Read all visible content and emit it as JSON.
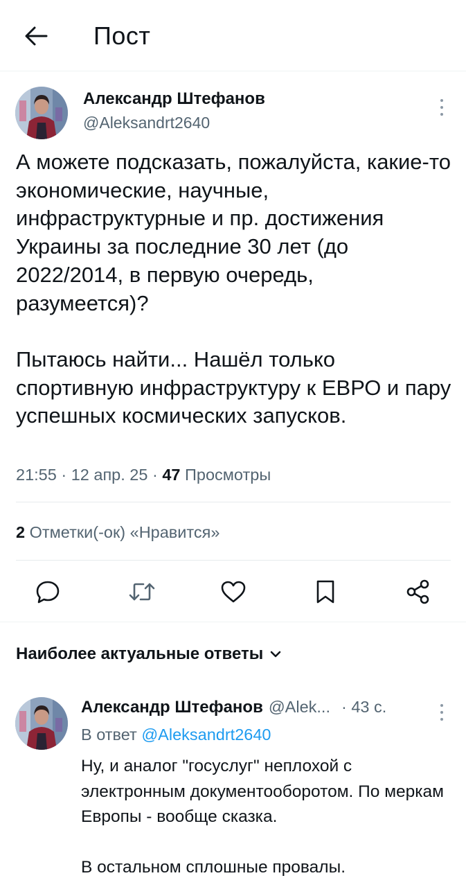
{
  "header": {
    "title": "Пост"
  },
  "tweet": {
    "author_name": "Александр Штефанов",
    "author_handle": "@Aleksandrt2640",
    "text": "А можете подсказать, пожалуйста, какие-то экономические, научные, инфраструктурные и пр. достижения Украины за последние 30 лет (до 2022/2014, в первую очередь, разумеется)?\n\nПытаюсь найти... Нашёл только спортивную инфраструктуру к ЕВРО и пару успешных космических запусков.",
    "time": "21:55",
    "date": "12 апр. 25",
    "separator": "·",
    "views_count": "47",
    "views_label": "Просмотры",
    "likes_count": "2",
    "likes_label": "Отметки(-ок) «Нравится»"
  },
  "actions": [
    "reply-icon",
    "retweet-icon",
    "like-icon",
    "bookmark-icon",
    "share-icon"
  ],
  "replies_section": {
    "sort_label": "Наиболее актуальные ответы"
  },
  "reply": {
    "author_name": "Александр Штефанов",
    "author_handle": "@Alek...",
    "time": "· 43 с.",
    "reply_to_prefix": "В ответ",
    "reply_to_handle": "@Aleksandrt2640",
    "text": "Ну, и аналог \"госуслуг\" неплохой с электронным документооборотом. По меркам Европы - вообще сказка.\n\nВ остальном сплошные провалы."
  },
  "colors": {
    "text_primary": "#0f1419",
    "text_secondary": "#536471",
    "link": "#1d9bf0",
    "divider": "#eff3f4"
  }
}
